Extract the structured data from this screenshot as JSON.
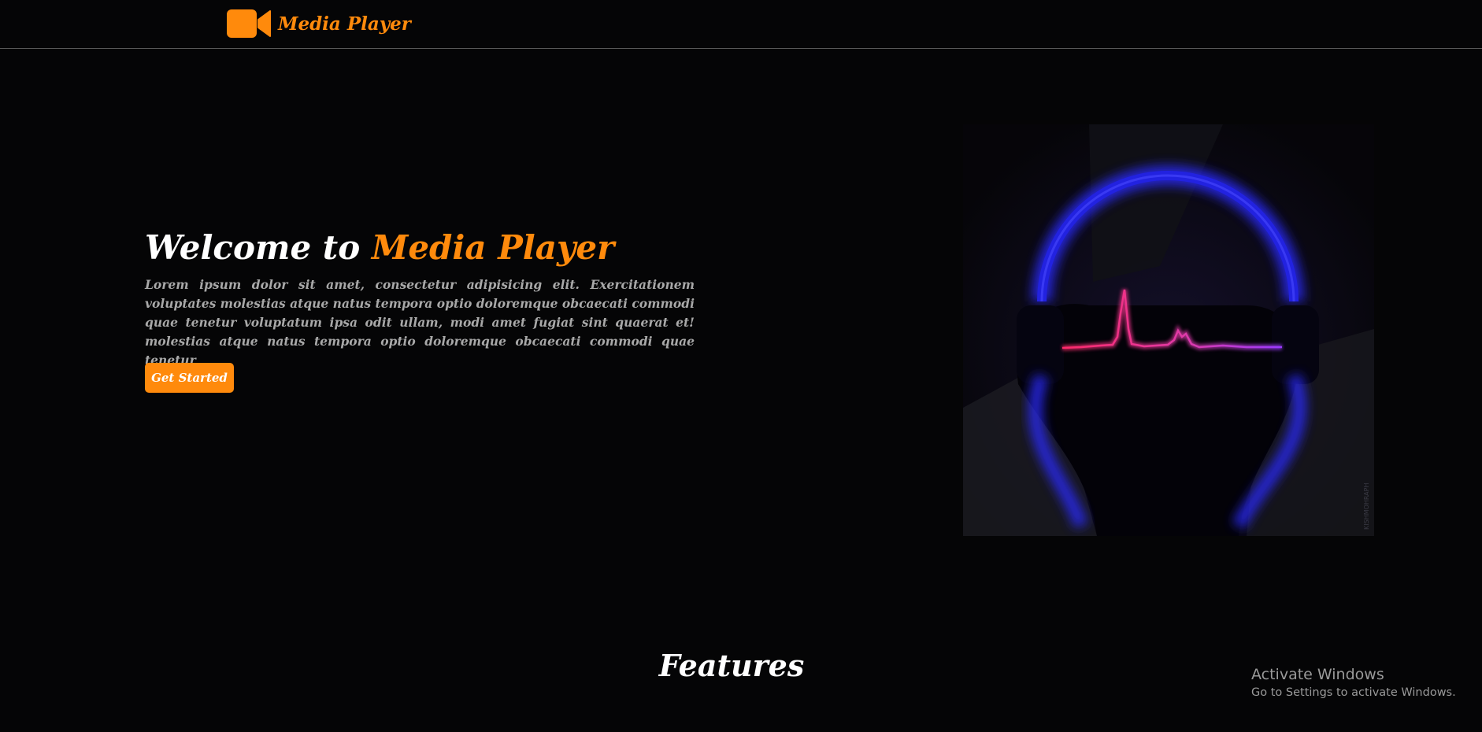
{
  "header": {
    "brand_name": "Media Player",
    "logo_icon": "video-camera-icon"
  },
  "hero": {
    "title_prefix": "Welcome to",
    "title_accent": "Media Player",
    "description": "Lorem ipsum dolor sit amet, consectetur adipisicing elit. Exercitationem voluptates molestias atque natus tempora optio doloremque obcaecati commodi quae tenetur voluptatum ipsa odit ullam, modi amet fugiat sint quaerat et! molestias atque natus tempora optio doloremque obcaecati commodi quae tenetur",
    "cta_label": "Get Started",
    "image": "headphones-heartbeat-illustration",
    "image_signature": "KISHMOHRAPH"
  },
  "features": {
    "title": "Features"
  },
  "os_watermark": {
    "title": "Activate Windows",
    "subtitle": "Go to Settings to activate Windows."
  },
  "colors": {
    "accent": "#ff8a0c",
    "background": "#050506",
    "text_muted": "#a8a8a8"
  }
}
